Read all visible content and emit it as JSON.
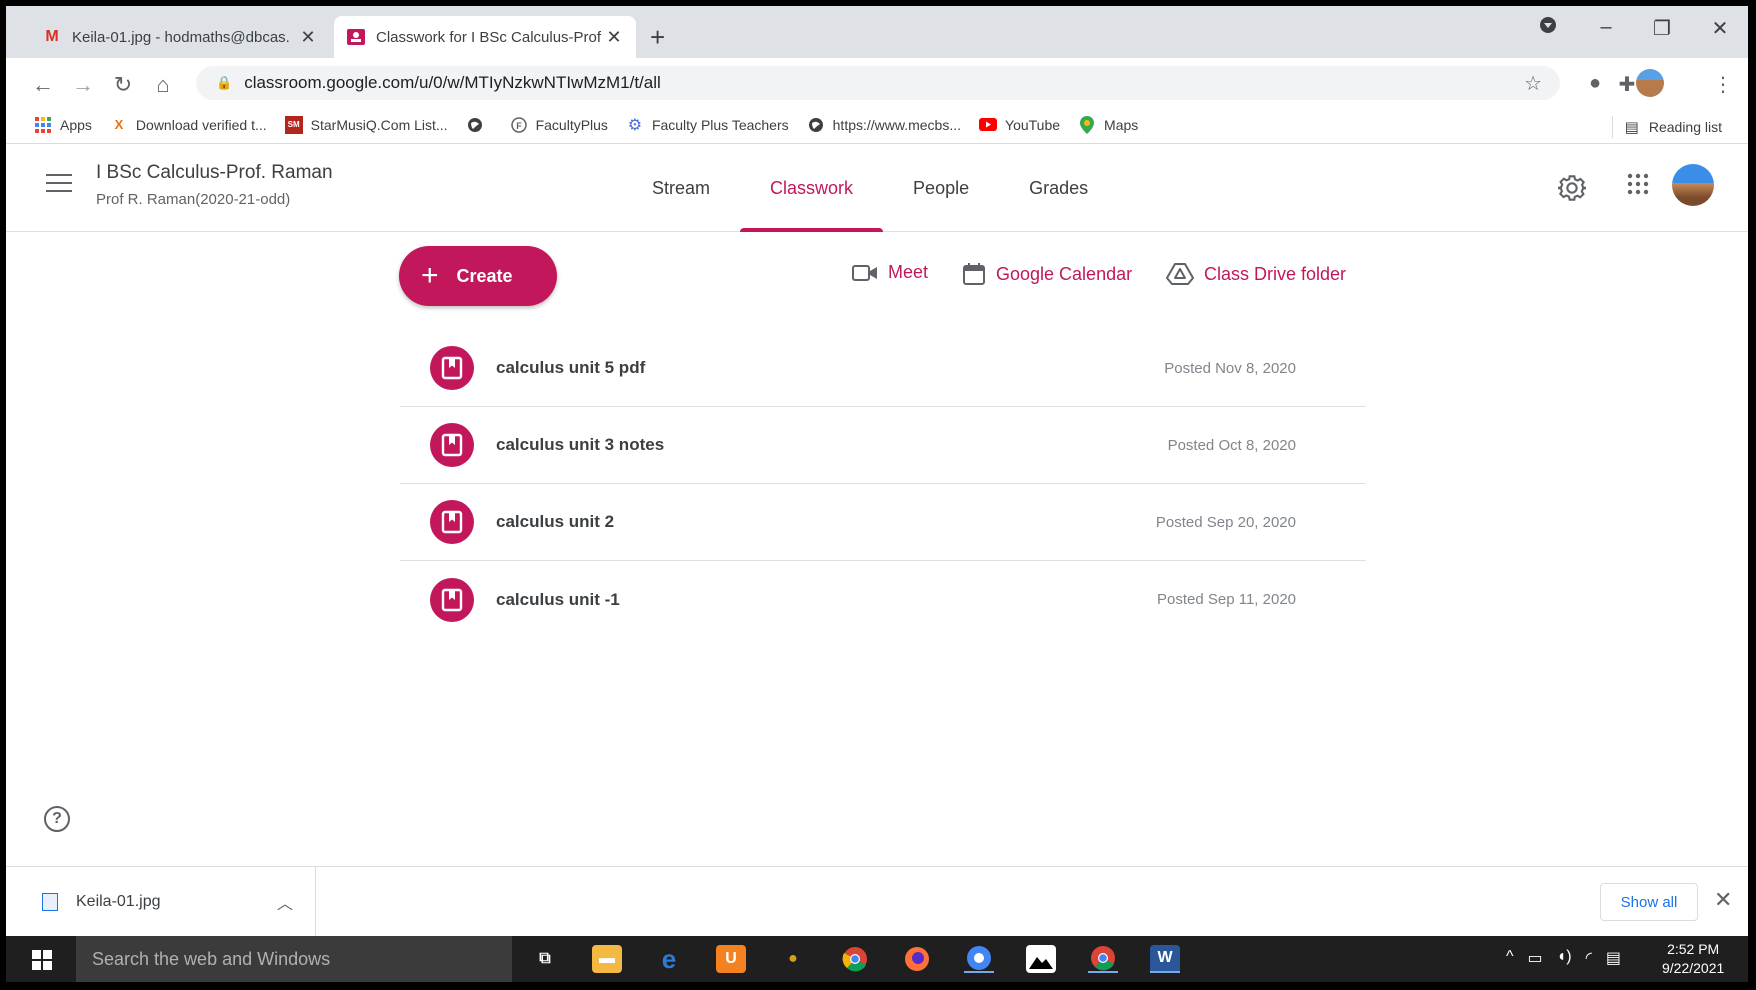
{
  "browser": {
    "tabs": [
      {
        "title": "Keila-01.jpg - hodmaths@dbcas.",
        "active": false
      },
      {
        "title": "Classwork for I BSc Calculus-Prof",
        "active": true
      }
    ],
    "url": "classroom.google.com/u/0/w/MTIyNzkwNTIwMzM1/t/all",
    "bookmarks": [
      {
        "label": "Apps",
        "icon": "apps-grid-icon"
      },
      {
        "label": "Download verified t...",
        "icon": "x-logo-icon"
      },
      {
        "label": "StarMusiQ.Com List...",
        "icon": "starmusiq-icon"
      },
      {
        "label": "",
        "icon": "globe-icon"
      },
      {
        "label": "FacultyPlus",
        "icon": "facultyplus-icon"
      },
      {
        "label": "Faculty Plus Teachers",
        "icon": "gear-blue-icon"
      },
      {
        "label": "https://www.mecbs...",
        "icon": "globe-icon"
      },
      {
        "label": "YouTube",
        "icon": "youtube-icon"
      },
      {
        "label": "Maps",
        "icon": "maps-pin-icon"
      }
    ],
    "reading_list": "Reading list"
  },
  "classroom": {
    "class_name": "I BSc Calculus-Prof. Raman",
    "class_subtitle": "Prof R. Raman(2020-21-odd)",
    "nav": [
      "Stream",
      "Classwork",
      "People",
      "Grades"
    ],
    "active_nav": "Classwork",
    "create_label": "Create",
    "quick_links": {
      "meet": "Meet",
      "calendar": "Google Calendar",
      "drive": "Class Drive folder"
    },
    "items": [
      {
        "title": "calculus unit 5 pdf",
        "posted": "Posted Nov 8, 2020"
      },
      {
        "title": "calculus unit 3 notes",
        "posted": "Posted Oct 8, 2020"
      },
      {
        "title": "calculus unit 2",
        "posted": "Posted Sep 20, 2020"
      },
      {
        "title": "calculus unit -1",
        "posted": "Posted Sep 11, 2020"
      }
    ],
    "help_symbol": "?"
  },
  "downloads": {
    "file": "Keila-01.jpg",
    "show_all": "Show all"
  },
  "taskbar": {
    "search_placeholder": "Search the web and Windows",
    "time": "2:52 PM",
    "date": "9/22/2021"
  },
  "colors": {
    "accent": "#c2185b",
    "chrome_bg": "#dee1e6"
  }
}
